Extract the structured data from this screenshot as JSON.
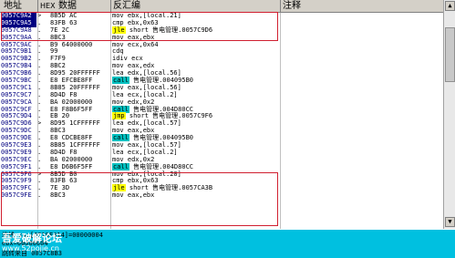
{
  "header": {
    "col_address": "地址",
    "col_hex_label": "HEX",
    "col_hex": "数据",
    "col_disasm": "反汇编",
    "col_comment": "注释"
  },
  "rows": [
    {
      "addr": "0057C9A2",
      "mark": ">",
      "hex": "8B5D AC",
      "asm": "mov ebx,[local.21]",
      "sel": true
    },
    {
      "addr": "0057C9A5",
      "mark": ".",
      "hex": "83FB 63",
      "asm": "cmp ebx,0x63",
      "sel": true
    },
    {
      "addr": "0057C9A8",
      "mark": ".",
      "hex": "7E 2C",
      "kw": "jle",
      "rest": " short 售电管理.0057C9D6",
      "hl": "jmp"
    },
    {
      "addr": "0057C9AA",
      "mark": ".",
      "hex": "8BC3",
      "asm": "mov eax,ebx"
    },
    {
      "addr": "0057C9AC",
      "mark": ".",
      "hex": "B9 64000000",
      "asm": "mov ecx,0x64"
    },
    {
      "addr": "0057C9B1",
      "mark": ".",
      "hex": "99",
      "asm": "cdq"
    },
    {
      "addr": "0057C9B2",
      "mark": ".",
      "hex": "F7F9",
      "asm": "idiv ecx"
    },
    {
      "addr": "0057C9B4",
      "mark": ".",
      "hex": "8BC2",
      "asm": "mov eax,edx"
    },
    {
      "addr": "0057C9B6",
      "mark": ".",
      "hex": "8D95 20FFFFFF",
      "asm": "lea edx,[local.56]"
    },
    {
      "addr": "0057C9BC",
      "mark": ".",
      "hex": "E8 EFCBE8FF",
      "kw": "call",
      "rest": " 售电管理.004095B0",
      "hl": "call"
    },
    {
      "addr": "0057C9C1",
      "mark": ".",
      "hex": "8B85 20FFFFFF",
      "asm": "mov eax,[local.56]"
    },
    {
      "addr": "0057C9C7",
      "mark": ".",
      "hex": "8D4D F8",
      "asm": "lea ecx,[local.2]"
    },
    {
      "addr": "0057C9CA",
      "mark": ".",
      "hex": "BA 02000000",
      "asm": "mov edx,0x2"
    },
    {
      "addr": "0057C9CF",
      "mark": ".",
      "hex": "E8 F8B6F5FF",
      "kw": "call",
      "rest": " 售电管理.004D80CC",
      "hl": "call"
    },
    {
      "addr": "0057C9D4",
      "mark": ".",
      "hex": "EB 20",
      "kw": "jmp",
      "rest": " short 售电管理.0057C9F6",
      "hl": "jmp"
    },
    {
      "addr": "0057C9D6",
      "mark": ">",
      "hex": "8D95 1CFFFFFF",
      "asm": "lea edx,[local.57]"
    },
    {
      "addr": "0057C9DC",
      "mark": ".",
      "hex": "8BC3",
      "asm": "mov eax,ebx"
    },
    {
      "addr": "0057C9DE",
      "mark": ".",
      "hex": "E8 CDCBE8FF",
      "kw": "call",
      "rest": " 售电管理.004095B0",
      "hl": "call"
    },
    {
      "addr": "0057C9E3",
      "mark": ".",
      "hex": "8B85 1CFFFFFF",
      "asm": "mov eax,[local.57]"
    },
    {
      "addr": "0057C9E9",
      "mark": ".",
      "hex": "8D4D F8",
      "asm": "lea ecx,[local.2]"
    },
    {
      "addr": "0057C9EC",
      "mark": ".",
      "hex": "BA 02000000",
      "asm": "mov edx,0x2"
    },
    {
      "addr": "0057C9F1",
      "mark": ".",
      "hex": "E8 D6B6F5FF",
      "kw": "call",
      "rest": " 售电管理.004D80CC",
      "hl": "call"
    },
    {
      "addr": "0057C9F6",
      "mark": ">",
      "hex": "8B5D B0",
      "asm": "mov ebx,[local.20]"
    },
    {
      "addr": "0057C9F9",
      "mark": ".",
      "hex": "83FB 63",
      "asm": "cmp ebx,0x63"
    },
    {
      "addr": "0057C9FC",
      "mark": ".",
      "hex": "7E 3D",
      "kw": "jle",
      "rest": " short 售电管理.0057CA3B",
      "hl": "jmp"
    },
    {
      "addr": "0057C9FE",
      "mark": ".",
      "hex": "8BC3",
      "asm": "mov eax,ebx"
    }
  ],
  "info": {
    "line1": "堆栈 ss:[0019F014]=00000004",
    "line2": "ebx=00000004",
    "line3": "跳转来自 0057C8B3"
  },
  "watermark": {
    "title": "吾爱破解论坛",
    "url": "www.52pojie.cn"
  },
  "colors": {
    "highlight_box": "#d02030",
    "call_bg": "#00c0c0",
    "jump_bg": "#ffff00",
    "info_bg": "#00c0e0",
    "address_sel_bg": "#000080"
  }
}
